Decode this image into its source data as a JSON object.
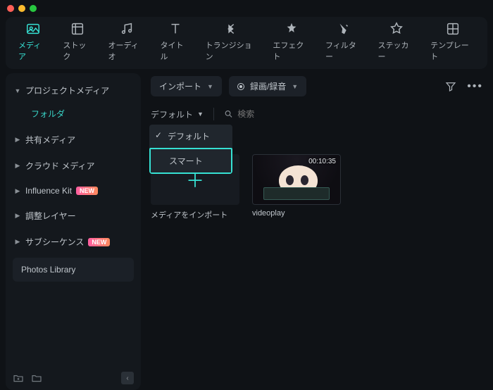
{
  "nav": {
    "items": [
      {
        "label": "メディア",
        "icon": "media"
      },
      {
        "label": "ストック",
        "icon": "stock"
      },
      {
        "label": "オーディオ",
        "icon": "audio"
      },
      {
        "label": "タイトル",
        "icon": "title"
      },
      {
        "label": "トランジション",
        "icon": "transition"
      },
      {
        "label": "エフェクト",
        "icon": "effect"
      },
      {
        "label": "フィルター",
        "icon": "filter"
      },
      {
        "label": "ステッカー",
        "icon": "sticker"
      },
      {
        "label": "テンプレート",
        "icon": "template"
      }
    ]
  },
  "sidebar": {
    "items": [
      {
        "label": "プロジェクトメディア",
        "expanded": true
      },
      {
        "label": "共有メディア"
      },
      {
        "label": "クラウド メディア"
      },
      {
        "label": "Influence Kit",
        "badge": "NEW"
      },
      {
        "label": "調整レイヤー"
      },
      {
        "label": "サブシーケンス",
        "badge": "NEW"
      }
    ],
    "sub_folder": "フォルダ",
    "photos": "Photos Library"
  },
  "toolbar": {
    "import": "インポート",
    "record": "録画/録音"
  },
  "filter": {
    "default_label": "デフォルト",
    "search_placeholder": "検索",
    "dropdown": {
      "option1": "デフォルト",
      "option2": "スマート"
    }
  },
  "grid": {
    "import_label": "メディアをインポート",
    "clip": {
      "name": "videoplay",
      "duration": "00:10:35"
    }
  }
}
